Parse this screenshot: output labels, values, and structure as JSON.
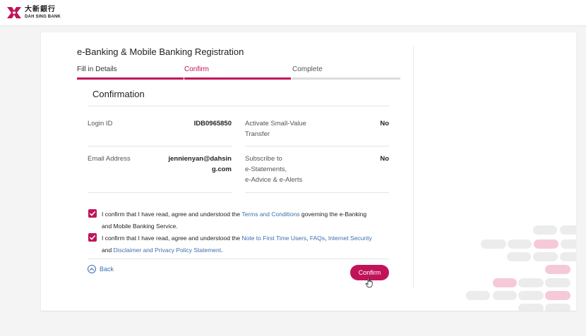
{
  "header": {
    "logo_cn": "大新銀行",
    "logo_en": "DAH SING BANK",
    "brand_color": "#c1135a"
  },
  "form": {
    "title": "e-Banking & Mobile Banking Registration",
    "steps": [
      {
        "label": "Fill in Details",
        "state": "done"
      },
      {
        "label": "Confirm",
        "state": "active"
      },
      {
        "label": "Complete",
        "state": "pending"
      }
    ],
    "section_title": "Confirmation",
    "fields": {
      "login_id_label": "Login ID",
      "login_id_value": "IDB0965850",
      "email_label": "Email Address",
      "email_value_line1": "jennienyan@dahsin",
      "email_value_line2": "g.com",
      "small_value_label_line1": "Activate Small-Value",
      "small_value_label_line2": "Transfer",
      "small_value_value": "No",
      "estatement_label_line1": "Subscribe to",
      "estatement_label_line2": "e-Statements,",
      "estatement_label_line3": "e-Advice & e-Alerts",
      "estatement_value": "No"
    },
    "consent1": {
      "checked": true,
      "text_a": "I confirm that I have read, agree and understood the ",
      "link1": "Terms and Conditions",
      "text_b": " governing the e-Banking",
      "text_c": "and Mobile Banking Service."
    },
    "consent2": {
      "checked": true,
      "text_a": "I confirm that I have read, agree and understood the ",
      "link1": "Note to First Time Users",
      "sep1": ", ",
      "link2": "FAQs",
      "sep2": ", ",
      "link3": "Internet Security",
      "text_b": "and ",
      "link4": "Disclaimer and Privacy Policy Statement",
      "text_c": "."
    },
    "back_label": "Back",
    "confirm_label": "Confirm"
  }
}
